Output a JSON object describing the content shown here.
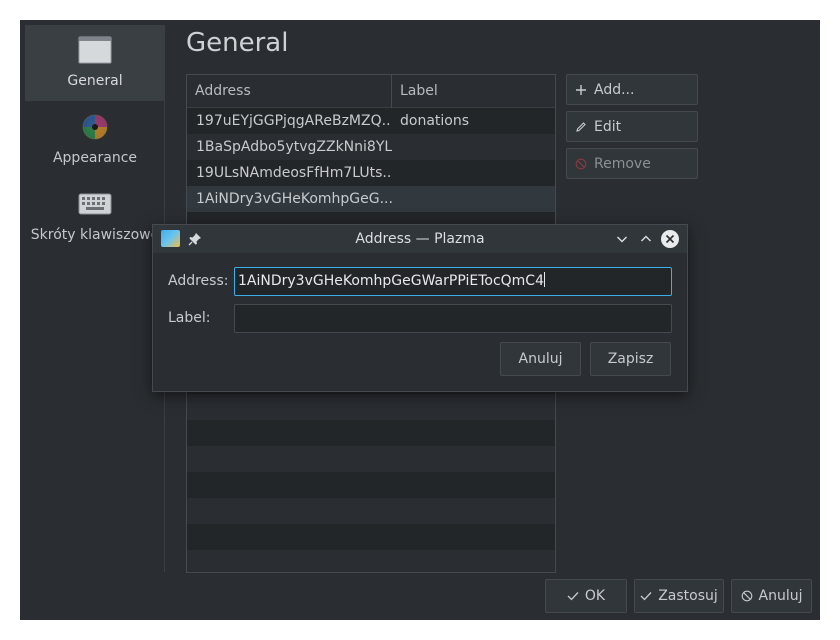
{
  "page_title": "General",
  "sidebar": {
    "items": [
      {
        "label": "General",
        "icon": "window-icon",
        "active": true
      },
      {
        "label": "Appearance",
        "icon": "color-disc-icon",
        "active": false
      },
      {
        "label": "Skróty klawiszowe",
        "icon": "keyboard-icon",
        "active": false
      }
    ]
  },
  "table": {
    "headers": {
      "address": "Address",
      "label": "Label"
    },
    "rows": [
      {
        "address": "197uEYjGGPjqgAReBzMZQ...",
        "label": "donations"
      },
      {
        "address": "1BaSpAdbo5ytvgZZkNni8YL...",
        "label": ""
      },
      {
        "address": "19ULsNAmdeosFfHm7LUts...",
        "label": ""
      },
      {
        "address": "1AiNDry3vGHeKomhpGeG...",
        "label": ""
      }
    ]
  },
  "actions": {
    "add": "Add...",
    "edit": "Edit",
    "remove": "Remove"
  },
  "footer": {
    "ok": "OK",
    "apply": "Zastosuj",
    "cancel": "Anuluj"
  },
  "dialog": {
    "title": "Address — Plazma",
    "address_label": "Address:",
    "address_value": "1AiNDry3vGHeKomhpGeGWarPPiETocQmC4",
    "label_label": "Label:",
    "label_value": "",
    "cancel": "Anuluj",
    "save": "Zapisz"
  },
  "colors": {
    "background": "#2a2e32",
    "accent": "#3daee9",
    "selected_row": "#31393f"
  }
}
